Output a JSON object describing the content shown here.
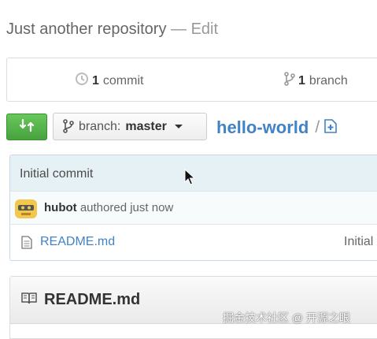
{
  "repo": {
    "description": "Just another repository",
    "separator": "—",
    "edit_label": "Edit",
    "name": "hello-world",
    "path_separator": "/"
  },
  "numbers": {
    "commits_count": "1",
    "commits_label": "commit",
    "branches_count": "1",
    "branches_label": "branch"
  },
  "branch_select": {
    "prefix": "branch:",
    "value": "master"
  },
  "commit": {
    "message": "Initial commit",
    "author": "hubot",
    "action": "authored just now"
  },
  "files": [
    {
      "name": "README.md",
      "message": "Initial"
    }
  ],
  "readme": {
    "title": "README.md"
  },
  "watermark": "掘金技术社区 @ 开源之眼",
  "icons": {
    "history": "history-icon",
    "branch": "git-branch-icon",
    "compare": "compare-icon",
    "new_file": "new-file-icon",
    "file": "file-text-icon",
    "book": "book-icon",
    "cursor": "mouse-cursor-icon"
  },
  "colors": {
    "link": "#4183c4",
    "compare_button": "#55b44a",
    "commit_header_bg": "#e6f1f6"
  }
}
